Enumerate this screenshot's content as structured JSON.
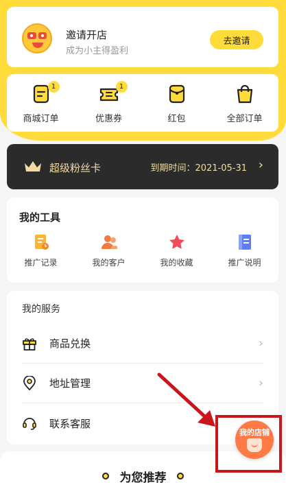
{
  "invite": {
    "title": "邀请开店",
    "subtitle": "成为小主得盈利",
    "button": "去邀请"
  },
  "orders": [
    {
      "label": "商城订单",
      "icon": "order-icon",
      "badge": "1"
    },
    {
      "label": "优惠券",
      "icon": "coupon-icon",
      "badge": "1"
    },
    {
      "label": "红包",
      "icon": "red-packet-icon",
      "badge": ""
    },
    {
      "label": "全部订单",
      "icon": "shopping-bag-icon",
      "badge": ""
    }
  ],
  "vip": {
    "title": "超级粉丝卡",
    "expire": "到期时间：2021-05-31",
    "arrow": "›"
  },
  "tools": {
    "title": "我的工具",
    "items": [
      {
        "label": "推广记录",
        "icon": "promotion-record-icon"
      },
      {
        "label": "我的客户",
        "icon": "customers-icon"
      },
      {
        "label": "我的收藏",
        "icon": "favorites-star-icon"
      },
      {
        "label": "推广说明",
        "icon": "promotion-guide-icon"
      }
    ]
  },
  "services": {
    "title": "我的服务",
    "items": [
      {
        "label": "商品兑换",
        "icon": "gift-icon",
        "chevron": "›"
      },
      {
        "label": "地址管理",
        "icon": "location-pin-icon",
        "chevron": "›"
      },
      {
        "label": "联系客服",
        "icon": "headset-icon",
        "chevron": ""
      }
    ]
  },
  "recommend": {
    "title": "为您推荐"
  },
  "store_fab": {
    "label": "我的店铺"
  },
  "colors": {
    "brand_yellow": "#ffdc3c",
    "dark_card": "#2b2b2b",
    "gold_text": "#f3dca0",
    "annotation_red": "#c8171a",
    "fab_orange": "#ff7a45"
  }
}
